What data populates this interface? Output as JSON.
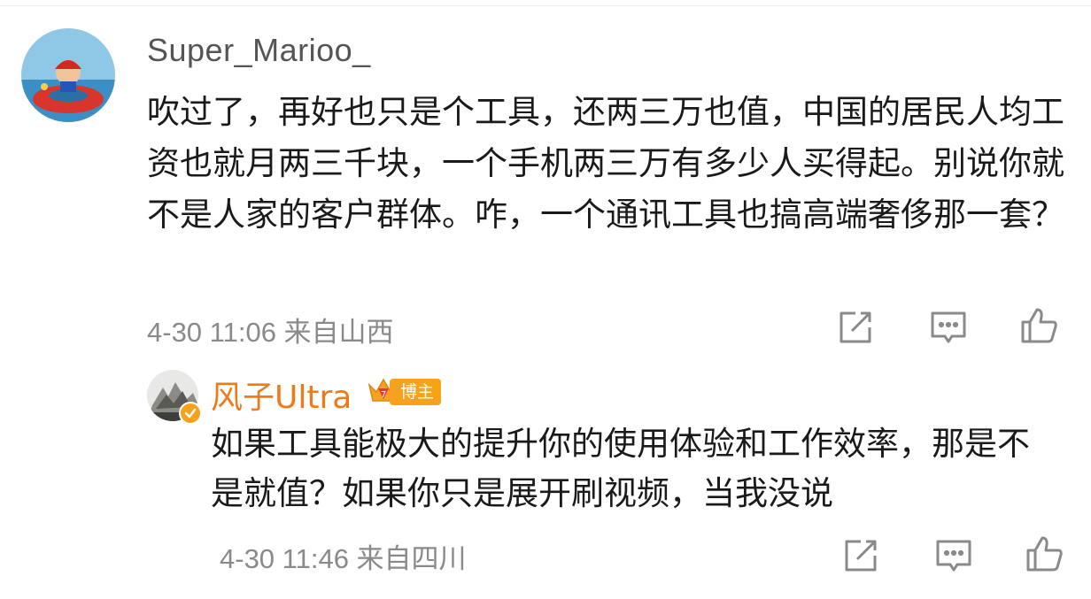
{
  "comment": {
    "username": "Super_Marioo_",
    "text": "吹过了，再好也只是个工具，还两三万也值，中国的居民人均工资也就月两三千块，一个手机两三万有多少人买得起。别说你就不是人家的客户群体。咋，一个通讯工具也搞高端奢侈那一套？",
    "meta": "4-30 11:06 来自山西",
    "icons": [
      "share-icon",
      "comment-icon",
      "like-icon"
    ]
  },
  "reply": {
    "username": "风子Ultra",
    "badge": "博主",
    "text": "如果工具能极大的提升你的使用体验和工作效率，那是不是就值？如果你只是展开刷视频，当我没说",
    "meta": "4-30 11:46 来自四川",
    "icons": [
      "share-icon",
      "comment-icon",
      "like-icon"
    ]
  },
  "colors": {
    "reply_name": "#ef7a1a",
    "badge_bg": "#f7a21d",
    "meta_text": "#8a8a8a",
    "icon_stroke": "#8a8a8a"
  }
}
